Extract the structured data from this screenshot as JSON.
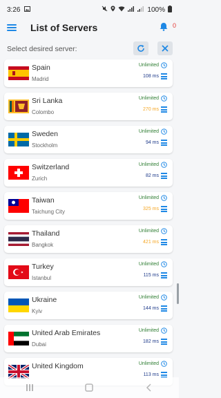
{
  "status": {
    "time": "3:26",
    "battery": "100%"
  },
  "header": {
    "title": "List of Servers",
    "notification_count": "0"
  },
  "subheader": {
    "text": "Select desired server:"
  },
  "servers": [
    {
      "country": "Spain",
      "city": "Madrid",
      "plan": "Unlimited",
      "ping": "108 ms",
      "ping_color": "#1e3a8a",
      "flag": "spain"
    },
    {
      "country": "Sri Lanka",
      "city": "Colombo",
      "plan": "Unlimited",
      "ping": "270 ms",
      "ping_color": "#f5a623",
      "flag": "srilanka"
    },
    {
      "country": "Sweden",
      "city": "Stockholm",
      "plan": "Unlimited",
      "ping": "94 ms",
      "ping_color": "#1e3a8a",
      "flag": "sweden"
    },
    {
      "country": "Switzerland",
      "city": "Zurich",
      "plan": "Unlimited",
      "ping": "82 ms",
      "ping_color": "#1e3a8a",
      "flag": "switzerland"
    },
    {
      "country": "Taiwan",
      "city": "Taichung City",
      "plan": "Unlimited",
      "ping": "325 ms",
      "ping_color": "#f5a623",
      "flag": "taiwan"
    },
    {
      "country": "Thailand",
      "city": "Bangkok",
      "plan": "Unlimited",
      "ping": "421 ms",
      "ping_color": "#f5a623",
      "flag": "thailand"
    },
    {
      "country": "Turkey",
      "city": "Istanbul",
      "plan": "Unlimited",
      "ping": "115 ms",
      "ping_color": "#1e3a8a",
      "flag": "turkey"
    },
    {
      "country": "Ukraine",
      "city": "Kyiv",
      "plan": "Unlimited",
      "ping": "144 ms",
      "ping_color": "#1e3a8a",
      "flag": "ukraine"
    },
    {
      "country": "United Arab Emirates",
      "city": "Dubai",
      "plan": "Unlimited",
      "ping": "182 ms",
      "ping_color": "#1e3a8a",
      "flag": "uae"
    },
    {
      "country": "United Kingdom",
      "city": "",
      "plan": "Unlimited",
      "ping": "113 ms",
      "ping_color": "#1e3a8a",
      "flag": "uk"
    }
  ],
  "colors": {
    "accent": "#1e88e5",
    "plan_green": "#2e7d32"
  }
}
